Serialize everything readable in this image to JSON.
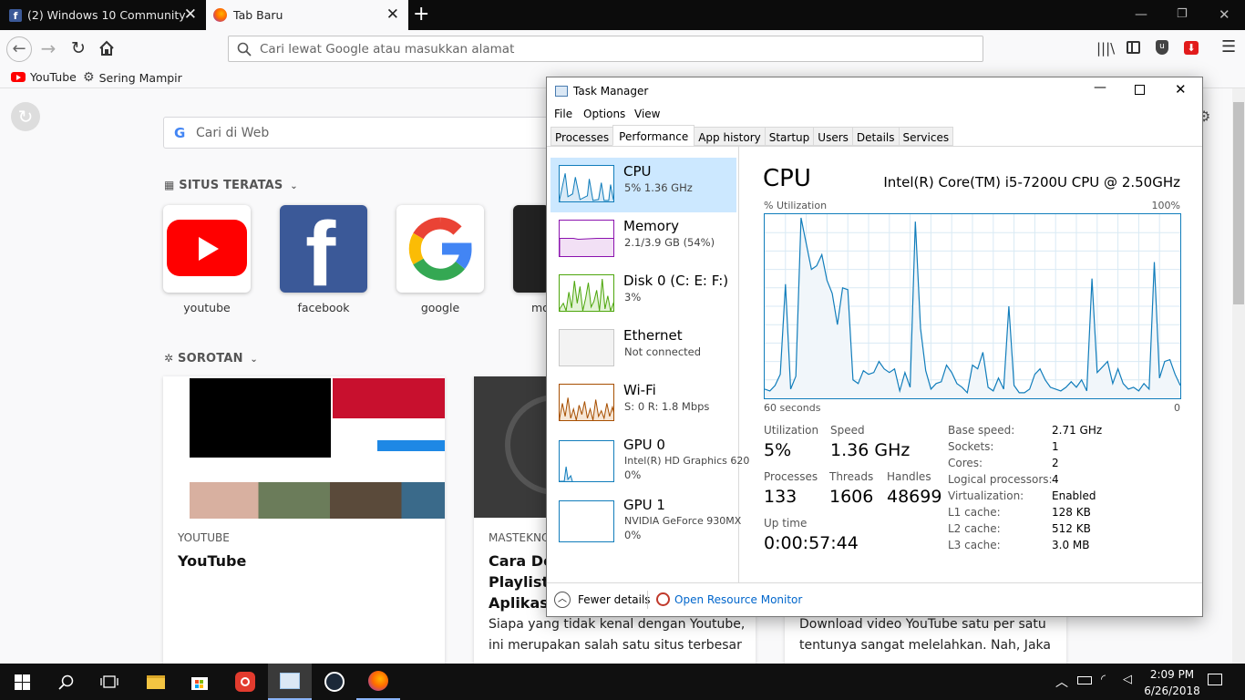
{
  "browser": {
    "tabs": [
      {
        "label": "(2) Windows 10 Community"
      },
      {
        "label": "Tab Baru"
      }
    ],
    "urlbar_placeholder": "Cari lewat Google atau masukkan alamat",
    "bookmarks": [
      {
        "label": "YouTube"
      },
      {
        "label": "Sering Mampir"
      }
    ]
  },
  "newtab": {
    "websearch_placeholder": "Cari di Web",
    "top_sites_heading": "SITUS TERATAS",
    "top_sites": [
      {
        "label": "youtube"
      },
      {
        "label": "facebook"
      },
      {
        "label": "google"
      },
      {
        "label": "mo"
      }
    ],
    "highlights_heading": "SOROTAN",
    "cards": [
      {
        "source": "YOUTUBE",
        "title": "YouTube"
      },
      {
        "source": "MASTEKNO",
        "title_lines": [
          "Cara Do",
          "Playlist ,",
          "Aplikasi"
        ],
        "text_lines": [
          "Siapa yang tidak kenal dengan Youtube,",
          "ini merupakan salah satu situs terbesar"
        ]
      },
      {
        "text_lines": [
          "Download video YouTube satu per satu",
          "tentunya sangat melelahkan. Nah, Jaka"
        ]
      }
    ]
  },
  "task_manager": {
    "title": "Task Manager",
    "menu": [
      "File",
      "Options",
      "View"
    ],
    "tabs": [
      "Processes",
      "Performance",
      "App history",
      "Startup",
      "Users",
      "Details",
      "Services"
    ],
    "active_tab": "Performance",
    "resources": [
      {
        "name": "CPU",
        "sub": "5%  1.36 GHz",
        "color": "#117dbb"
      },
      {
        "name": "Memory",
        "sub": "2.1/3.9 GB (54%)",
        "color": "#8b12ae"
      },
      {
        "name": "Disk 0 (C: E: F:)",
        "sub": "3%",
        "color": "#4da60c"
      },
      {
        "name": "Ethernet",
        "sub": "Not connected",
        "color": "#a0a0a0"
      },
      {
        "name": "Wi-Fi",
        "sub": "S: 0  R: 1.8 Mbps",
        "color": "#a74f01"
      },
      {
        "name": "GPU 0",
        "sub": "Intel(R) HD Graphics 620",
        "sub2": "0%",
        "color": "#117dbb"
      },
      {
        "name": "GPU 1",
        "sub": "NVIDIA GeForce 930MX",
        "sub2": "0%",
        "color": "#117dbb"
      }
    ],
    "cpu": {
      "heading": "CPU",
      "model": "Intel(R) Core(TM) i5-7200U CPU @ 2.50GHz",
      "graph_label_left": "% Utilization",
      "graph_label_right": "100%",
      "graph_bottom_left": "60 seconds",
      "graph_bottom_right": "0",
      "utilization_history": [
        5,
        4,
        7,
        13,
        62,
        5,
        12,
        98,
        84,
        70,
        72,
        78,
        64,
        57,
        40,
        60,
        59,
        10,
        8,
        15,
        13,
        14,
        20,
        16,
        14,
        16,
        4,
        14,
        6,
        96,
        38,
        15,
        5,
        8,
        9,
        18,
        14,
        8,
        6,
        3,
        18,
        16,
        25,
        6,
        4,
        11,
        5,
        50,
        7,
        3,
        3,
        5,
        13,
        16,
        10,
        6,
        5,
        4,
        6,
        9,
        6,
        10,
        4,
        65,
        14,
        17,
        20,
        8,
        16,
        8,
        5,
        6,
        4,
        8,
        5,
        74,
        11,
        20,
        21,
        13,
        7
      ],
      "stats": {
        "utilization_label": "Utilization",
        "utilization": "5%",
        "speed_label": "Speed",
        "speed": "1.36 GHz",
        "processes_label": "Processes",
        "processes": "133",
        "threads_label": "Threads",
        "threads": "1606",
        "handles_label": "Handles",
        "handles": "48699",
        "uptime_label": "Up time",
        "uptime": "0:00:57:44"
      },
      "details": [
        {
          "k": "Base speed:",
          "v": "2.71 GHz"
        },
        {
          "k": "Sockets:",
          "v": "1"
        },
        {
          "k": "Cores:",
          "v": "2"
        },
        {
          "k": "Logical processors:",
          "v": "4"
        },
        {
          "k": "Virtualization:",
          "v": "Enabled"
        },
        {
          "k": "L1 cache:",
          "v": "128 KB"
        },
        {
          "k": "L2 cache:",
          "v": "512 KB"
        },
        {
          "k": "L3 cache:",
          "v": "3.0 MB"
        }
      ]
    },
    "fewer_details": "Fewer details",
    "open_resource_monitor": "Open Resource Monitor"
  },
  "taskbar": {
    "time": "2:09 PM",
    "date": "6/26/2018"
  }
}
